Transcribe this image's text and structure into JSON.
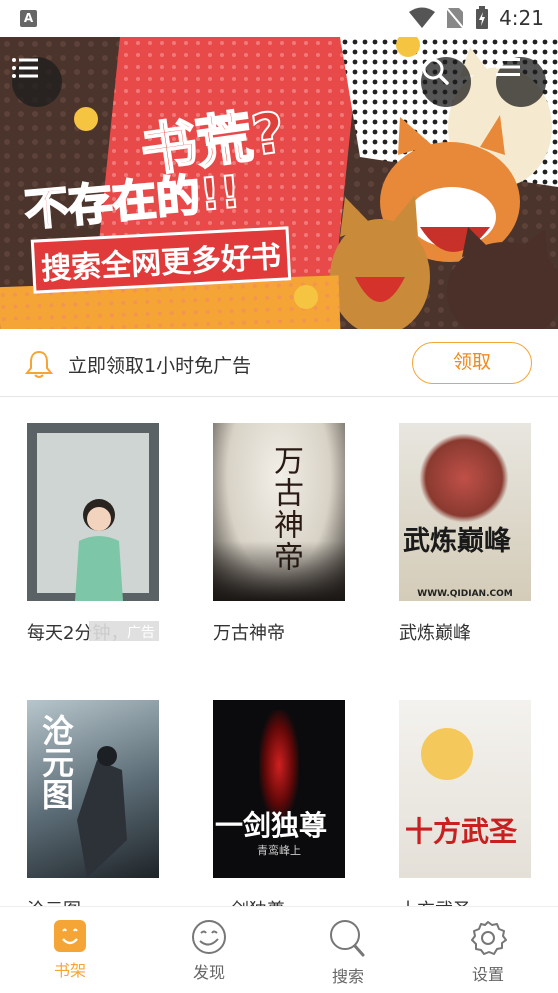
{
  "status_bar": {
    "time": "4:21",
    "app_badge": "A"
  },
  "banner": {
    "headline_1": "书荒?",
    "headline_2": "不存在的!!",
    "headline_3": "搜索全网更多好书"
  },
  "notice": {
    "text": "立即领取1小时免广告",
    "button_label": "领取"
  },
  "books": [
    {
      "title": "每天2分钟，",
      "ad_label": "广告"
    },
    {
      "title": "万古神帝",
      "cover_text": "万古神帝"
    },
    {
      "title": "武炼巅峰",
      "cover_text": "武炼巅峰",
      "cover_footer": "WWW.QIDIAN.COM"
    },
    {
      "title": "沧元图",
      "cover_text": "沧元图"
    },
    {
      "title": "一剑独尊",
      "cover_text": "一剑独尊",
      "cover_footer": "青鸾峰上"
    },
    {
      "title": "十方武圣",
      "cover_text": "十方武圣"
    }
  ],
  "tabs": [
    {
      "label": "书架",
      "icon": "bookshelf-icon",
      "active": true
    },
    {
      "label": "发现",
      "icon": "discover-icon"
    },
    {
      "label": "搜索",
      "icon": "search-icon"
    },
    {
      "label": "设置",
      "icon": "settings-icon"
    }
  ],
  "colors": {
    "accent": "#f5a536",
    "banner_red": "#e0403a"
  }
}
